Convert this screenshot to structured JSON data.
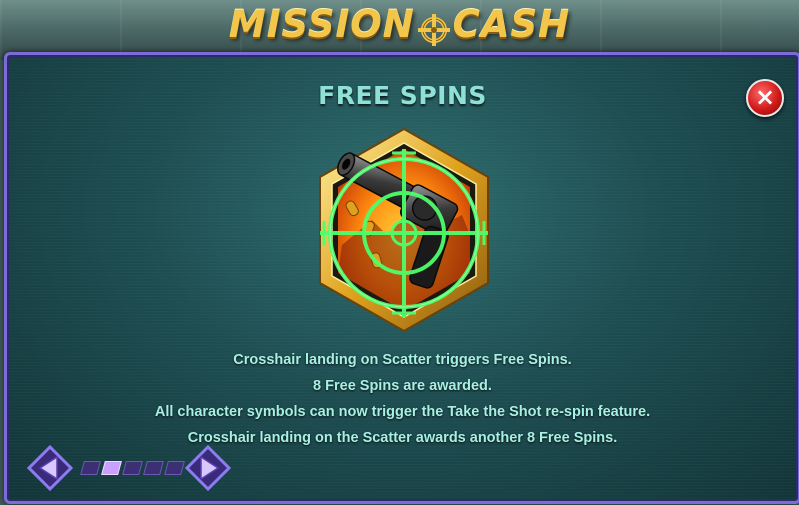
{
  "game": {
    "logo_left": "MISSION",
    "logo_right": "CASH"
  },
  "panel": {
    "title": "FREE SPINS",
    "symbol_icon": "crosshair-gun-scatter-icon",
    "description": [
      "Crosshair landing on Scatter triggers Free Spins.",
      "8 Free Spins are awarded.",
      "All character symbols can now trigger the Take the Shot re-spin feature.",
      "Crosshair landing on the Scatter awards another 8 Free Spins."
    ],
    "close_label": "×"
  },
  "pagination": {
    "total_pages": 5,
    "current_page": 2
  },
  "colors": {
    "title": "#8fe1d8",
    "text": "#a8f0e3",
    "accent_purple": "#7d6bd8",
    "crosshair": "#4dff6a",
    "gold": "#f2c64a"
  }
}
